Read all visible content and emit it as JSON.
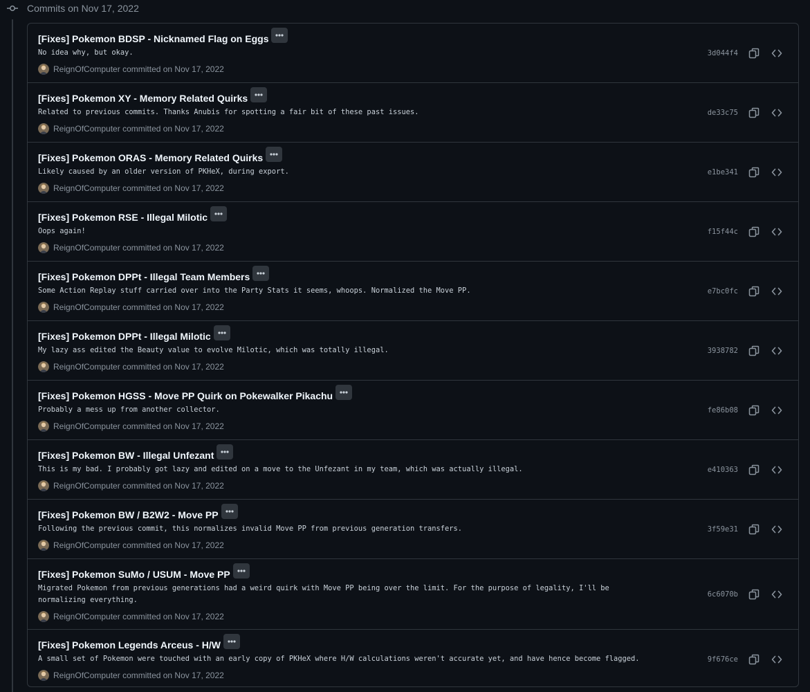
{
  "group": {
    "title": "Commits on Nov 17, 2022"
  },
  "commits": [
    {
      "title": "[Fixes] Pokemon BDSP - Nicknamed Flag on Eggs",
      "description": "No idea why, but okay.",
      "author": "ReignOfComputer",
      "committed": "committed on Nov 17, 2022",
      "sha": "3d044f4"
    },
    {
      "title": "[Fixes] Pokemon XY - Memory Related Quirks",
      "description": "Related to previous commits. Thanks Anubis for spotting a fair bit of these past issues.",
      "author": "ReignOfComputer",
      "committed": "committed on Nov 17, 2022",
      "sha": "de33c75"
    },
    {
      "title": "[Fixes] Pokemon ORAS - Memory Related Quirks",
      "description": "Likely caused by an older version of PKHeX, during export.",
      "author": "ReignOfComputer",
      "committed": "committed on Nov 17, 2022",
      "sha": "e1be341"
    },
    {
      "title": "[Fixes] Pokemon RSE - Illegal Milotic",
      "description": "Oops again!",
      "author": "ReignOfComputer",
      "committed": "committed on Nov 17, 2022",
      "sha": "f15f44c"
    },
    {
      "title": "[Fixes] Pokemon DPPt - Illegal Team Members",
      "description": "Some Action Replay stuff carried over into the Party Stats it seems, whoops. Normalized the Move PP.",
      "author": "ReignOfComputer",
      "committed": "committed on Nov 17, 2022",
      "sha": "e7bc0fc"
    },
    {
      "title": "[Fixes] Pokemon DPPt - Illegal Milotic",
      "description": "My lazy ass edited the Beauty value to evolve Milotic, which was totally illegal.",
      "author": "ReignOfComputer",
      "committed": "committed on Nov 17, 2022",
      "sha": "3938782"
    },
    {
      "title": "[Fixes] Pokemon HGSS - Move PP Quirk on Pokewalker Pikachu",
      "description": "Probably a mess up from another collector.",
      "author": "ReignOfComputer",
      "committed": "committed on Nov 17, 2022",
      "sha": "fe86b08"
    },
    {
      "title": "[Fixes] Pokemon BW - Illegal Unfezant",
      "description": "This is my bad. I probably got lazy and edited on a move to the Unfezant in my team, which was actually illegal.",
      "author": "ReignOfComputer",
      "committed": "committed on Nov 17, 2022",
      "sha": "e410363"
    },
    {
      "title": "[Fixes] Pokemon BW / B2W2 - Move PP",
      "description": "Following the previous commit, this normalizes invalid Move PP from previous generation transfers.",
      "author": "ReignOfComputer",
      "committed": "committed on Nov 17, 2022",
      "sha": "3f59e31"
    },
    {
      "title": "[Fixes] Pokemon SuMo / USUM - Move PP",
      "description": "Migrated Pokemon from previous generations had a weird quirk with Move PP being over the limit. For the purpose of legality, I'll be normalizing everything.",
      "author": "ReignOfComputer",
      "committed": "committed on Nov 17, 2022",
      "sha": "6c6070b"
    },
    {
      "title": "[Fixes] Pokemon Legends Arceus - H/W",
      "description": "A small set of Pokemon were touched with an early copy of PKHeX where H/W calculations weren't accurate yet, and have hence become flagged.",
      "author": "ReignOfComputer",
      "committed": "committed on Nov 17, 2022",
      "sha": "9f676ce"
    }
  ]
}
